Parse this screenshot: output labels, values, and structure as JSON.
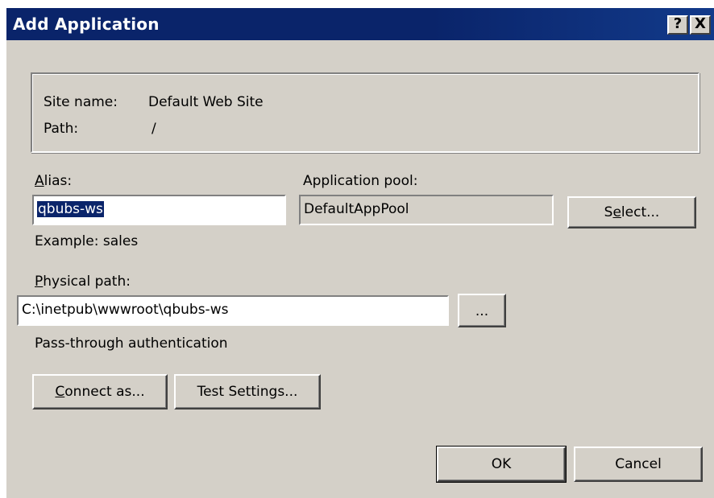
{
  "window": {
    "title": "Add Application",
    "help_glyph": "?",
    "close_glyph": "X"
  },
  "site_info": {
    "site_name_label": "Site name:",
    "site_name_value": "Default Web Site",
    "path_label": "Path:",
    "path_value": "/"
  },
  "alias": {
    "label_access": "A",
    "label_rest": "lias:",
    "value": "qbubs-ws"
  },
  "application_pool": {
    "label": "Application pool:",
    "value": "DefaultAppPool",
    "select_button_pre": "S",
    "select_button_access": "e",
    "select_button_post": "lect..."
  },
  "example_text": "Example: sales",
  "physical_path": {
    "label_access": "P",
    "label_rest": "hysical path:",
    "value": "C:\\inetpub\\wwwroot\\qbubs-ws",
    "browse_label": "..."
  },
  "auth_text": "Pass-through authentication",
  "buttons": {
    "connect_as_access": "C",
    "connect_as_rest": "onnect as...",
    "test_settings": "Test Settings...",
    "ok": "OK",
    "cancel": "Cancel"
  },
  "colors": {
    "titlebar": "#0a246a",
    "dialog_face": "#d4d0c8",
    "selection": "#0a246a"
  },
  "icons": {
    "help": "question-mark-icon",
    "close": "close-icon"
  }
}
